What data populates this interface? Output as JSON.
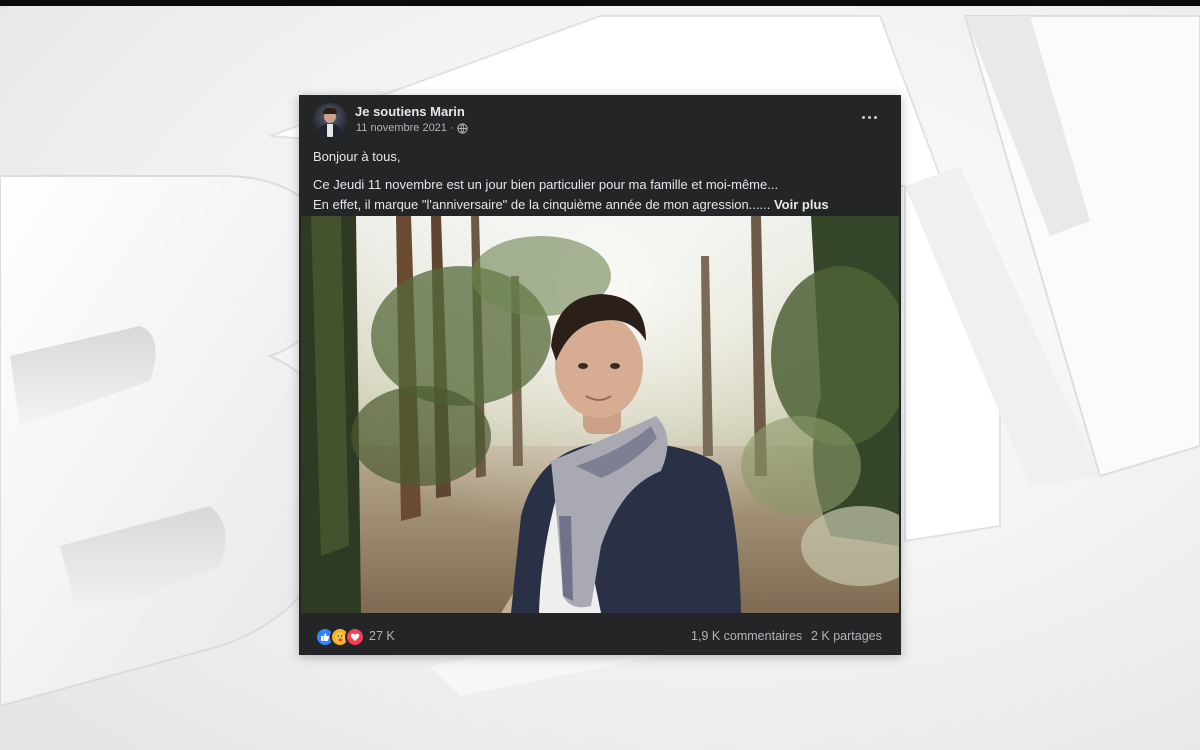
{
  "post": {
    "page_name": "Je soutiens Marin",
    "date": "11 novembre 2021",
    "separator": "·",
    "privacy_icon": "globe-icon",
    "more_icon": "more-horizontal-icon",
    "text": {
      "greeting": "Bonjour à tous,",
      "line1": "Ce Jeudi 11 novembre est un jour bien particulier pour ma famille et moi-même...",
      "line2": "En effet, il marque \"l'anniversaire\" de la cinquième année de mon agression......",
      "see_more": "Voir plus"
    },
    "photo_icon": "post-photo",
    "stats": {
      "reactions": [
        "like-icon",
        "care-icon",
        "love-icon"
      ],
      "reaction_count": "27 K",
      "comments": "1,9 K commentaires",
      "shares": "2 K partages"
    }
  },
  "colors": {
    "post_background": "#242526",
    "text_primary": "#e4e6eb",
    "text_secondary": "#b0b3b8",
    "like": "#2d86ff",
    "care": "#f7b125",
    "love": "#f33e58"
  }
}
